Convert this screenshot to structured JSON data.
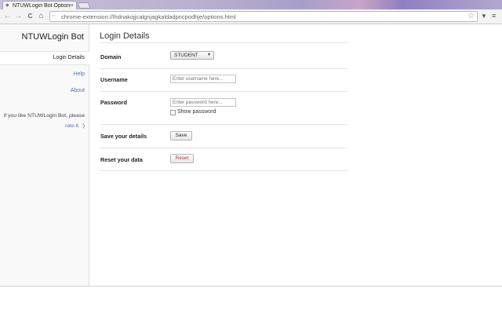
{
  "browser": {
    "tab_title": "NTUWLogin Bot Options",
    "tab_close": "×",
    "url": "chrome-extension://lhdnakojjcalgnjagkaldadpncpodhje/options.html",
    "back_icon": "←",
    "forward_icon": "→",
    "reload_icon": "C",
    "home_icon": "⌂",
    "star_icon": "☆",
    "menu_icon": "≡",
    "extension_icon": "▼"
  },
  "sidebar": {
    "brand": "NTUWLogin Bot",
    "items": [
      {
        "label": "Login Details",
        "active": true
      },
      {
        "label": "Help",
        "active": false
      },
      {
        "label": "About",
        "active": false
      }
    ],
    "promo_text": "If you like NTUWLogin Bot, please",
    "promo_link": "rate it.",
    "promo_smiley": ":)"
  },
  "main": {
    "title": "Login Details",
    "domain": {
      "label": "Domain",
      "selected": "STUDENT",
      "caret": "▾"
    },
    "username": {
      "label": "Username",
      "placeholder": "Enter username here..."
    },
    "password": {
      "label": "Password",
      "placeholder": "Enter password here...",
      "show_label": "Show password",
      "show_checked": false
    },
    "save": {
      "label": "Save your details",
      "button": "Save"
    },
    "reset": {
      "label": "Reset your data",
      "button": "Reset"
    }
  },
  "colors": {
    "link": "#5472b5",
    "reset_text": "#b33a3a"
  }
}
